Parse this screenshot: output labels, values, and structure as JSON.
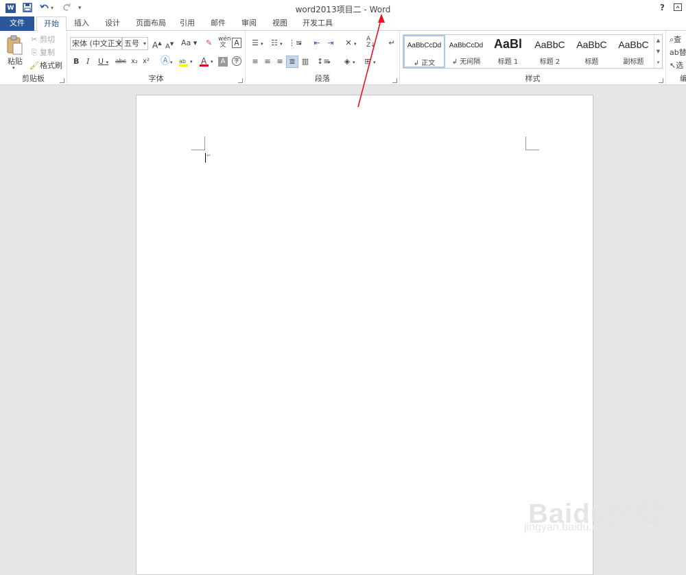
{
  "window": {
    "title": "word2013项目二 - Word",
    "help": "?",
    "restore_icon": "restore-icon"
  },
  "qat": {
    "app_logo": "W",
    "save_icon": "save-icon",
    "undo_icon": "undo-icon",
    "redo_icon": "redo-icon",
    "customize_icon": "dropdown-icon"
  },
  "tabs": [
    {
      "label": "文件"
    },
    {
      "label": "开始"
    },
    {
      "label": "插入"
    },
    {
      "label": "设计"
    },
    {
      "label": "页面布局"
    },
    {
      "label": "引用"
    },
    {
      "label": "邮件"
    },
    {
      "label": "审阅"
    },
    {
      "label": "视图"
    },
    {
      "label": "开发工具"
    }
  ],
  "clipboard": {
    "paste": "粘贴",
    "cut": "剪切",
    "copy": "复制",
    "format_painter": "格式刷",
    "label": "剪贴板"
  },
  "font": {
    "font_name": "宋体 (中文正文",
    "font_size": "五号",
    "grow": "A",
    "shrink": "A",
    "change_case": "Aa",
    "bold": "B",
    "italic": "I",
    "underline": "U",
    "strike": "abc",
    "subscript": "x₂",
    "superscript": "x²",
    "label": "字体",
    "font_color": "#e0001b",
    "highlight_color": "#fff200"
  },
  "paragraph": {
    "label": "段落"
  },
  "styles": {
    "label": "样式",
    "items": [
      {
        "sample": "AaBbCcDd",
        "name": "↲ 正文"
      },
      {
        "sample": "AaBbCcDd",
        "name": "↲ 无间隔"
      },
      {
        "sample": "AaBl",
        "name": "标题 1"
      },
      {
        "sample": "AaBbC",
        "name": "标题 2"
      },
      {
        "sample": "AaBbC",
        "name": "标题"
      },
      {
        "sample": "AaBbC",
        "name": "副标题"
      }
    ]
  },
  "editing": {
    "find": "查",
    "replace": "替",
    "select": "选",
    "label": "编"
  },
  "watermark": {
    "main": "Baidu经验",
    "sub": "jingyan.baidu.com"
  },
  "colors": {
    "accent": "#2b579a",
    "arrow": "#e8141c"
  }
}
